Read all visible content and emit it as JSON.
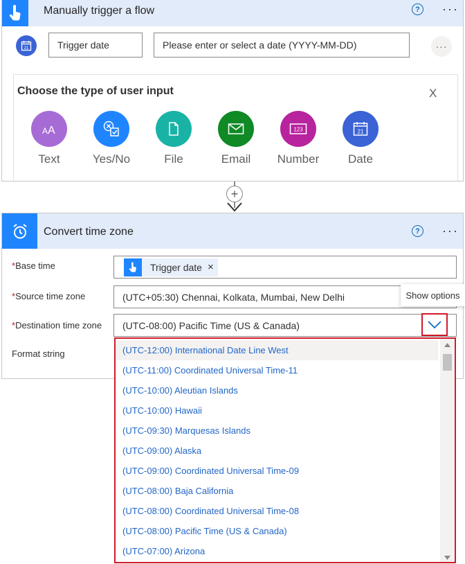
{
  "trigger_card": {
    "title": "Manually trigger a flow",
    "help_glyph": "?",
    "more_glyph": "···",
    "input_name": "Trigger date",
    "input_placeholder": "Please enter or select a date (YYYY-MM-DD)",
    "input_more_glyph": "···",
    "choose_title": "Choose the type of user input",
    "close_glyph": "X",
    "types": [
      {
        "label": "Text",
        "icon": "text-icon",
        "color": "#a76bd6"
      },
      {
        "label": "Yes/No",
        "icon": "yes-no-icon",
        "color": "#1f85ff"
      },
      {
        "label": "File",
        "icon": "file-icon",
        "color": "#19b3a6"
      },
      {
        "label": "Email",
        "icon": "email-icon",
        "color": "#0f8a25"
      },
      {
        "label": "Number",
        "icon": "number-icon",
        "color": "#b8239e"
      },
      {
        "label": "Date",
        "icon": "calendar-icon",
        "color": "#3b63d6"
      }
    ]
  },
  "connector": {
    "plus_glyph": "+"
  },
  "convert_card": {
    "title": "Convert time zone",
    "help_glyph": "?",
    "more_glyph": "···",
    "fields": {
      "base_time": {
        "label": "Base time",
        "token": "Trigger date",
        "token_remove": "×"
      },
      "source_tz": {
        "label": "Source time zone",
        "value": "(UTC+05:30) Chennai, Kolkata, Mumbai, New Delhi"
      },
      "dest_tz": {
        "label": "Destination time zone",
        "value": "(UTC-08:00) Pacific Time (US & Canada)"
      },
      "format": {
        "label": "Format string"
      }
    },
    "required_mark": "*",
    "tooltip": "Show options"
  },
  "dropdown_options": [
    "(UTC-12:00) International Date Line West",
    "(UTC-11:00) Coordinated Universal Time-11",
    "(UTC-10:00) Aleutian Islands",
    "(UTC-10:00) Hawaii",
    "(UTC-09:30) Marquesas Islands",
    "(UTC-09:00) Alaska",
    "(UTC-09:00) Coordinated Universal Time-09",
    "(UTC-08:00) Baja California",
    "(UTC-08:00) Coordinated Universal Time-08",
    "(UTC-08:00) Pacific Time (US & Canada)",
    "(UTC-07:00) Arizona"
  ],
  "colors": {
    "header_bg": "#e2ebf9",
    "accent_blue": "#1f85ff",
    "highlight_red": "#d11a2a",
    "option_text": "#2266c8"
  }
}
